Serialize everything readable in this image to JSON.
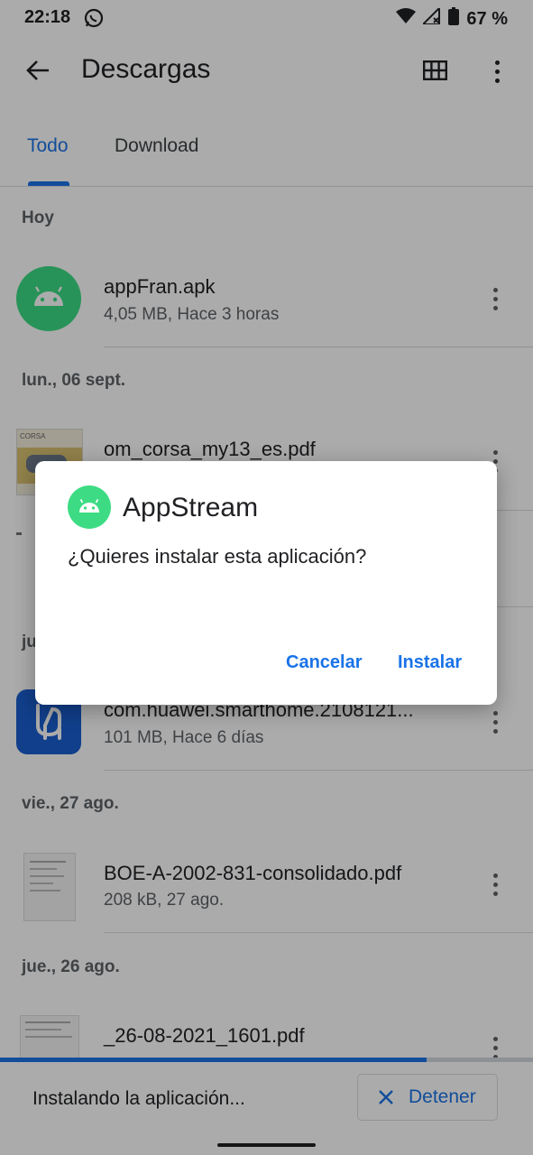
{
  "status_bar": {
    "time": "22:18",
    "battery": "67 %"
  },
  "app_bar": {
    "title": "Descargas"
  },
  "tabs": [
    {
      "label": "Todo"
    },
    {
      "label": "Download"
    }
  ],
  "sections": {
    "today": "Hoy",
    "sep06": "lun., 06 sept.",
    "jul": "ju",
    "aug27": "vie., 27 ago.",
    "aug26": "jue., 26 ago."
  },
  "files": {
    "apk": {
      "name": "appFran.apk",
      "meta": "4,05 MB, Hace 3 horas"
    },
    "corsa": {
      "name": "om_corsa_my13_es.pdf",
      "thumb_text": "CORSA"
    },
    "huawei": {
      "name": "com.huawei.smarthome.2108121...",
      "meta": "101 MB, Hace 6 días"
    },
    "boe": {
      "name": "BOE-A-2002-831-consolidado.pdf",
      "meta": "208 kB, 27 ago."
    },
    "pdf2608": {
      "name": "_26-08-2021_1601.pdf"
    }
  },
  "dialog": {
    "app_name": "AppStream",
    "message": "¿Quieres instalar esta aplicación?",
    "cancel": "Cancelar",
    "install": "Instalar"
  },
  "bottom": {
    "status": "Instalando la aplicación...",
    "stop": "Detener",
    "progress": 0.8
  },
  "colors": {
    "accent": "#1a73e8",
    "android_green": "#3ddc84",
    "huawei_blue": "#1a5fd0"
  }
}
